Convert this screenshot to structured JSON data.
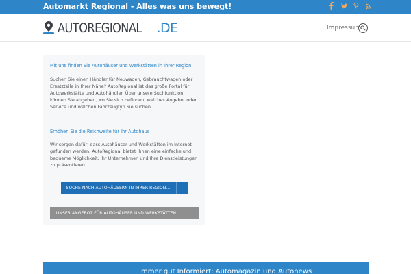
{
  "topbar": {
    "tagline": "Automarkt Regional - Alles was uns bewegt!",
    "social": [
      "facebook-icon",
      "twitter-icon",
      "pinterest-icon",
      "rss-icon"
    ],
    "background": "#2e86c9"
  },
  "header": {
    "logo_text": "AUTOREGIONAL",
    "logo_suffix": ".DE",
    "nav_impressum": "Impressum"
  },
  "panel": {
    "heading1": "Mit uns finden Sie Autohäuser und Werkstätten in Ihrer Region",
    "para1": "Suchen Sie einen Händler für Neuwagen, Gebrauchtwagen oder Ersatzteile in Ihrer Nähe? AutoRegional ist das große Portal für Autowerkstätte und Autohändler. Über unsere Suchfunktion können Sie angeben, wo Sie sich befinden, welches Angebot oder Service und welchen Fahrzeugtyp Sie suchen.",
    "heading2": "Erhöhen Sie die Reichweite für Ihr Autohaus",
    "para2": "Wir sorgen dafür, dass Autohäuser und Werkstätten im Internet gefunden werden. AutoRegional bietet Ihnen eine einfache und bequeme Möglichkeit, Ihr Unternehmen und Ihre Dienstleistungen zu präsentieren.",
    "button_search": "SUCHE NACH AUTOHÄUSERN IN IHRER REGION...",
    "button_offer": "UNSER ANGEBOT FÜR AUTOHÄUSER UND WERKSTÄTTEN..."
  },
  "banner": {
    "text": "Immer gut Informiert: Automagazin und Autonews"
  },
  "colors": {
    "accent": "#2e86c9",
    "button_blue": "#1f6fb6",
    "button_grey": "#8f8f8f",
    "panel_bg": "#f5f7f9"
  }
}
